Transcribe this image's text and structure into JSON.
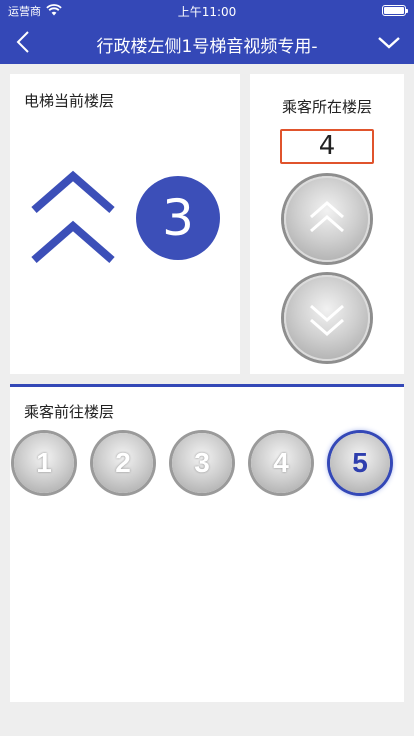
{
  "status_bar": {
    "carrier": "运营商",
    "time": "上午11:00"
  },
  "nav": {
    "title": "行政楼左侧1号梯音视频专用-",
    "back_icon": "chevron-left-icon",
    "dropdown_icon": "chevron-down-icon"
  },
  "current_panel": {
    "label": "电梯当前楼层",
    "floor": "3",
    "direction_icon": "double-chevron-up-icon"
  },
  "passenger_panel": {
    "label": "乘客所在楼层",
    "floor_value": "4",
    "up_icon": "chevron-up-icon",
    "down_icon": "chevron-down-icon"
  },
  "target_panel": {
    "label": "乘客前往楼层",
    "floors": [
      "1",
      "2",
      "3",
      "4",
      "5"
    ],
    "selected": "5"
  },
  "colors": {
    "accent": "#3448b7",
    "input_border": "#e0532c",
    "background": "#eeeeee"
  }
}
